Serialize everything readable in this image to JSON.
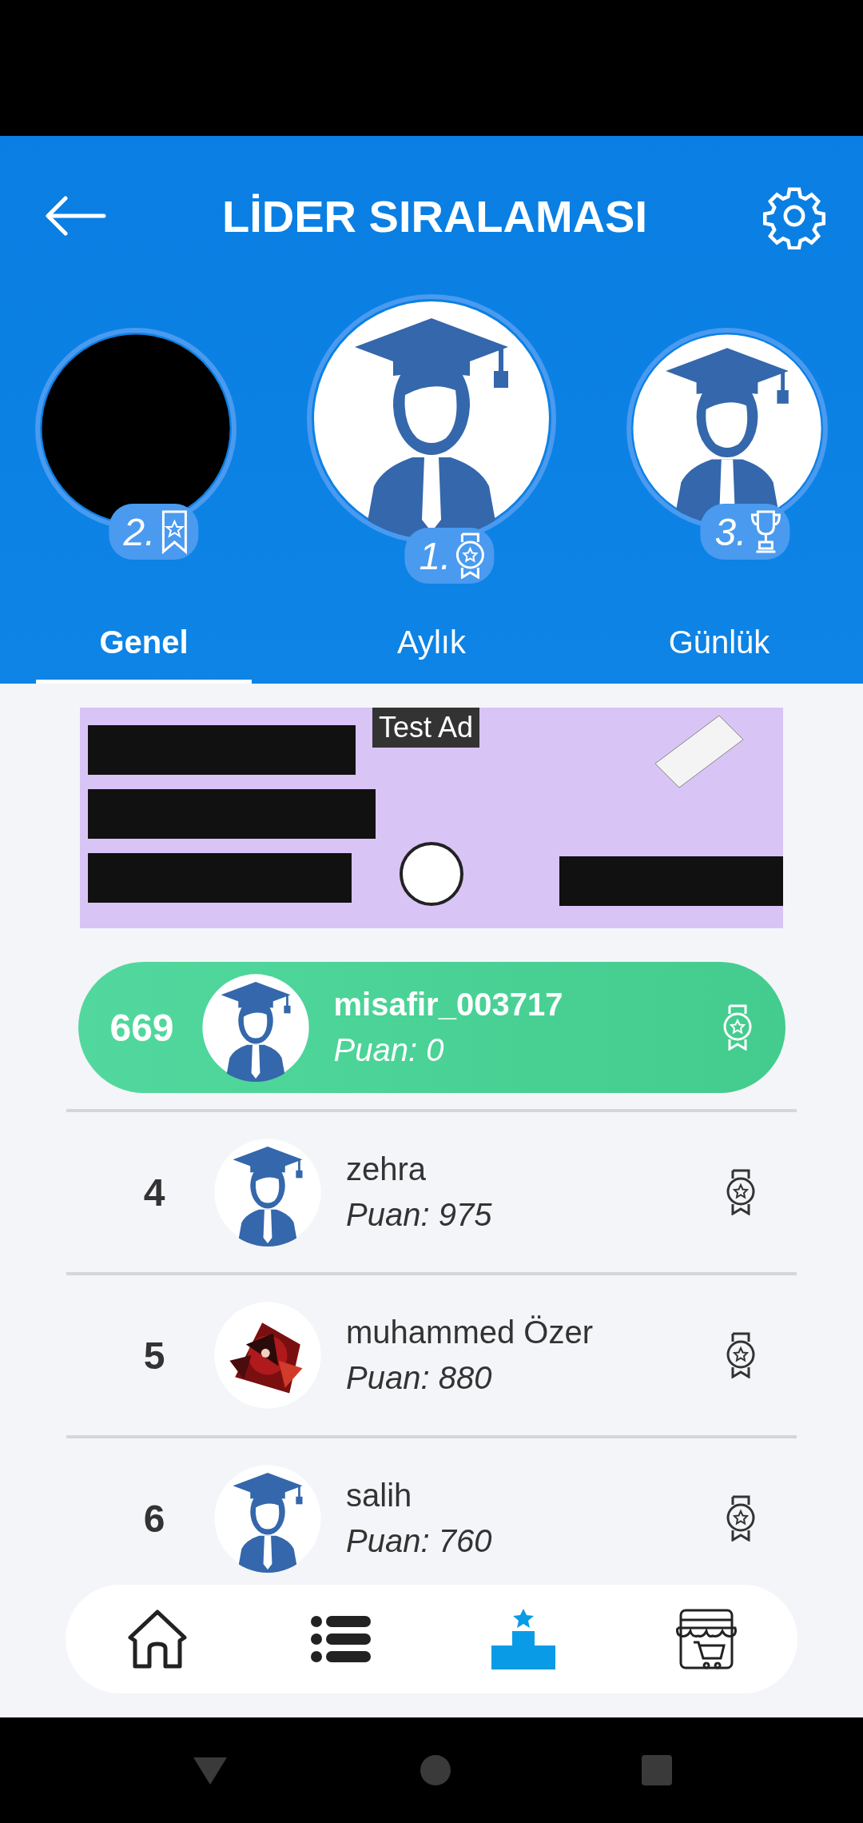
{
  "header": {
    "title": "LİDER SIRALAMASI"
  },
  "podium": [
    {
      "rank": "2.",
      "avatar": {
        "kind": "dark"
      },
      "award": {
        "kind": "ribbon"
      }
    },
    {
      "rank": "1.",
      "avatar": {
        "kind": "graduate"
      },
      "award": {
        "kind": "medal"
      }
    },
    {
      "rank": "3.",
      "avatar": {
        "kind": "graduate"
      },
      "award": {
        "kind": "trophy"
      }
    }
  ],
  "tabs": [
    {
      "label": "Genel",
      "selected": true
    },
    {
      "label": "Aylık",
      "selected": false
    },
    {
      "label": "Günlük",
      "selected": false
    }
  ],
  "ad": {
    "label": "Test Ad"
  },
  "current_user": {
    "rank": "669",
    "avatar": {
      "kind": "graduate"
    },
    "name": "misafir_003717",
    "score": "Puan: 0"
  },
  "rows": [
    {
      "rank": "4",
      "avatar": {
        "kind": "graduate"
      },
      "name": "zehra",
      "score": "Puan: 975"
    },
    {
      "rank": "5",
      "name": "muhammed Özer",
      "score": "Puan: 880"
    },
    {
      "rank": "6",
      "avatar": {
        "kind": "graduate"
      },
      "name": "salih",
      "score": "Puan: 760"
    }
  ],
  "bottom_nav": [
    {
      "kind": "home",
      "selected": false
    },
    {
      "kind": "list",
      "selected": false
    },
    {
      "kind": "podium",
      "selected": true
    },
    {
      "kind": "shop",
      "selected": false
    }
  ]
}
